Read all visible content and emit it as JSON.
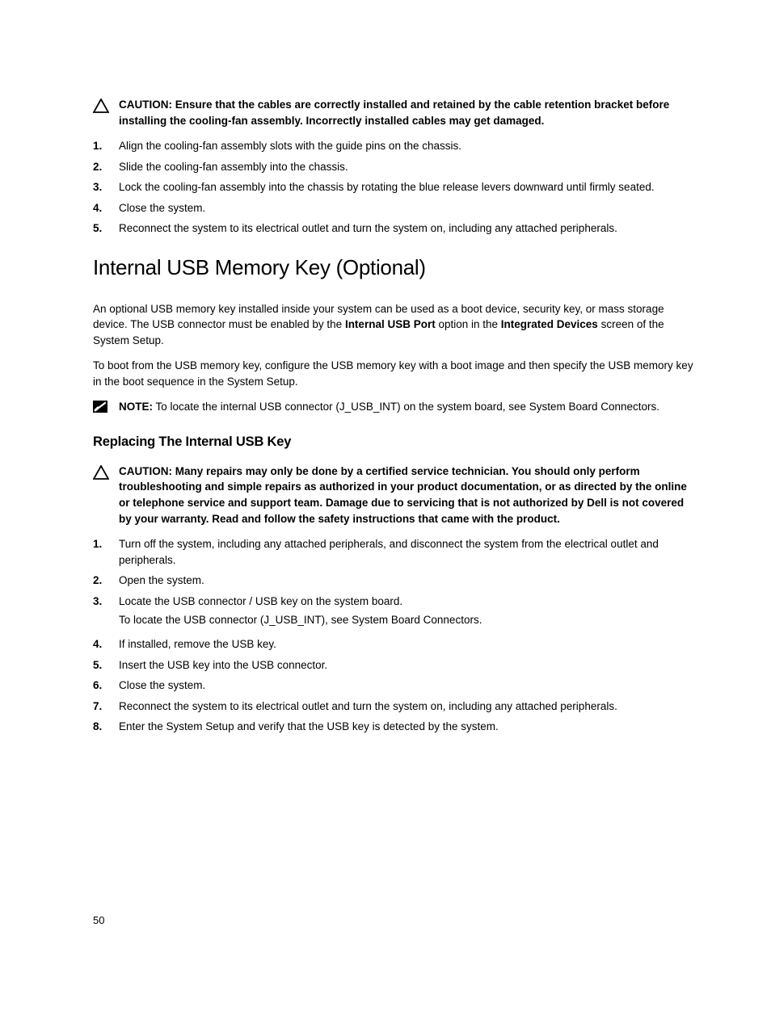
{
  "caution1": {
    "label": "CAUTION:",
    "text": "Ensure that the cables are correctly installed and retained by the cable retention bracket before installing the cooling-fan assembly. Incorrectly installed cables may get damaged."
  },
  "steps1": [
    {
      "n": "1.",
      "text": "Align the cooling-fan assembly slots with the guide pins on the chassis."
    },
    {
      "n": "2.",
      "text": "Slide the cooling-fan assembly into the chassis."
    },
    {
      "n": "3.",
      "text": "Lock the cooling-fan assembly into the chassis by rotating the blue release levers downward until firmly seated."
    },
    {
      "n": "4.",
      "text": "Close the system."
    },
    {
      "n": "5.",
      "text": "Reconnect the system to its electrical outlet and turn the system on, including any attached peripherals."
    }
  ],
  "heading_main": "Internal USB Memory Key (Optional)",
  "para1_a": "An optional USB memory key installed inside your system can be used as a boot device, security key, or mass storage device. The USB connector must be enabled by the ",
  "para1_bold1": "Internal USB Port",
  "para1_b": " option in the ",
  "para1_bold2": "Integrated Devices",
  "para1_c": " screen of the System Setup.",
  "para2": "To boot from the USB memory key, configure the USB memory key with a boot image and then specify the USB memory key in the boot sequence in the System Setup.",
  "note1": {
    "label": "NOTE:",
    "text": " To locate the internal USB connector (J_USB_INT) on the system board, see System Board Connectors."
  },
  "heading_sub": "Replacing The Internal USB Key",
  "caution2": {
    "label": "CAUTION:",
    "text": " Many repairs may only be done by a certified service technician. You should only perform troubleshooting and simple repairs as authorized in your product documentation, or as directed by the online or telephone service and support team. Damage due to servicing that is not authorized by Dell is not covered by your warranty. Read and follow the safety instructions that came with the product."
  },
  "steps2": [
    {
      "n": "1.",
      "text": "Turn off the system, including any attached peripherals, and disconnect the system from the electrical outlet and peripherals."
    },
    {
      "n": "2.",
      "text": "Open the system."
    },
    {
      "n": "3.",
      "text": "Locate the USB connector / USB key on the system board.",
      "text2": "To locate the USB connector (J_USB_INT), see System Board Connectors."
    },
    {
      "n": "4.",
      "text": "If installed, remove the USB key."
    },
    {
      "n": "5.",
      "text": "Insert the USB key into the USB connector."
    },
    {
      "n": "6.",
      "text": "Close the system."
    },
    {
      "n": "7.",
      "text": "Reconnect the system to its electrical outlet and turn the system on, including any attached peripherals."
    },
    {
      "n": "8.",
      "text": "Enter the System Setup and verify that the USB key is detected by the system."
    }
  ],
  "page_number": "50"
}
